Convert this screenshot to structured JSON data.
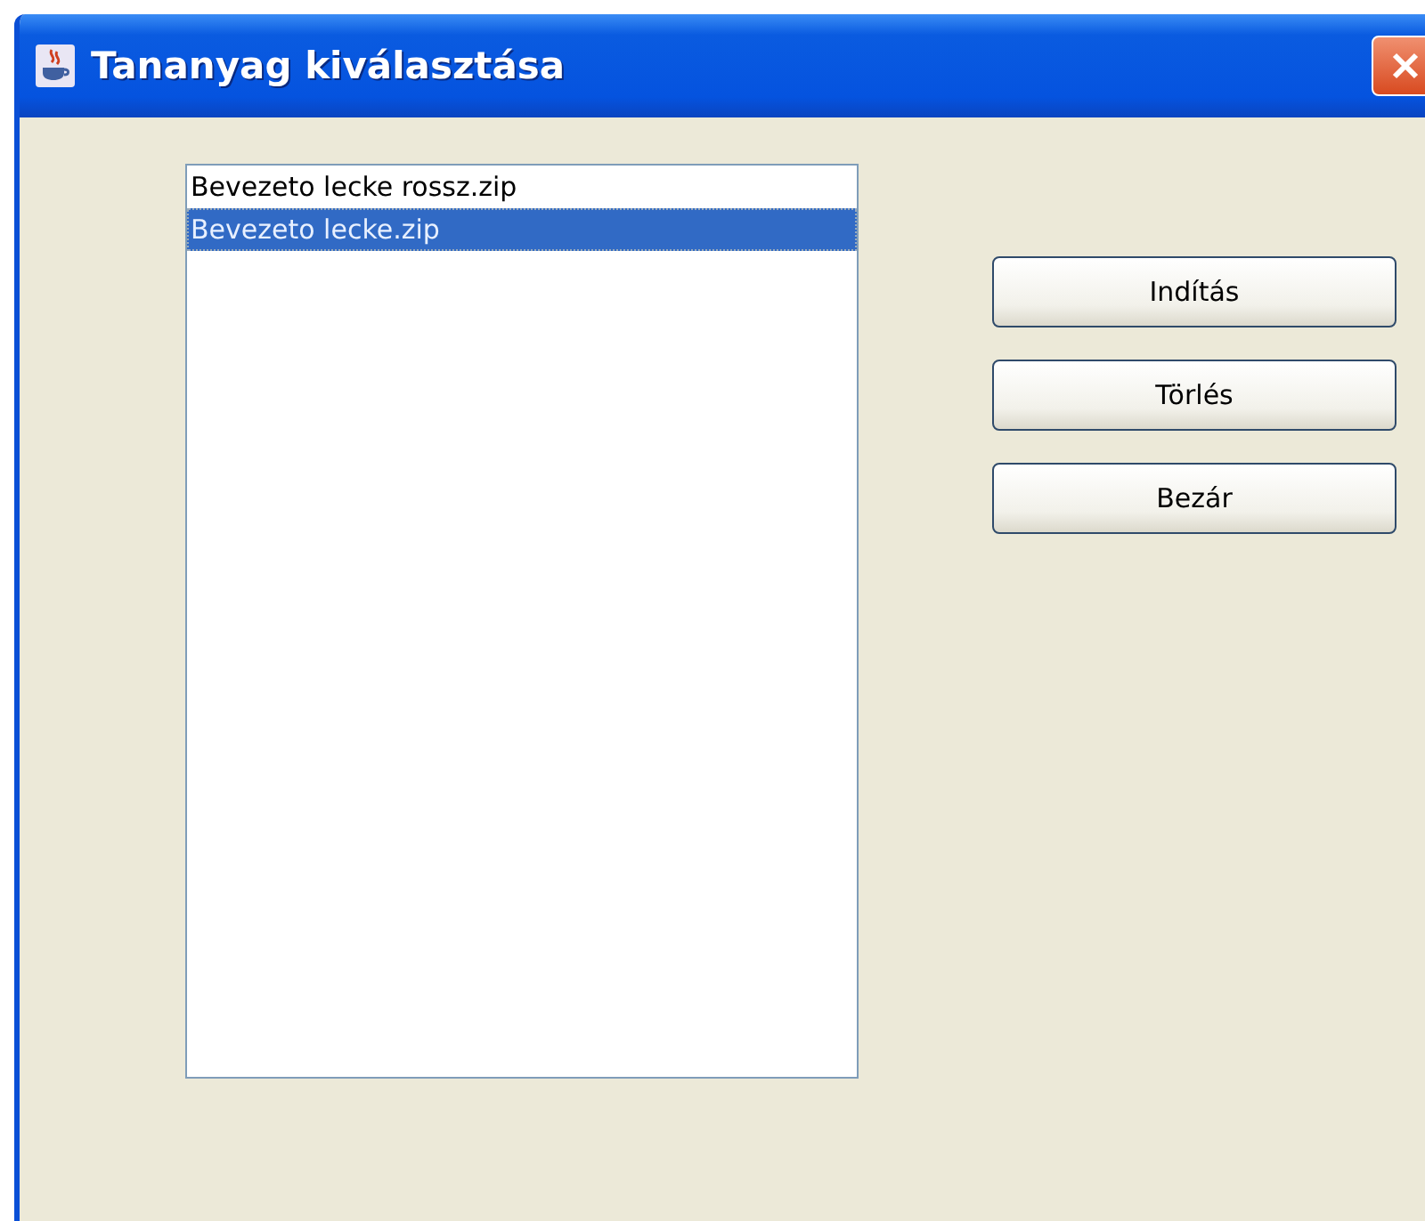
{
  "window": {
    "title": "Tananyag kiválasztása"
  },
  "list": {
    "items": [
      {
        "label": "Bevezeto lecke rossz.zip",
        "selected": false
      },
      {
        "label": "Bevezeto lecke.zip",
        "selected": true
      }
    ]
  },
  "buttons": [
    "Indítás",
    "Törlés",
    "Bezár"
  ]
}
